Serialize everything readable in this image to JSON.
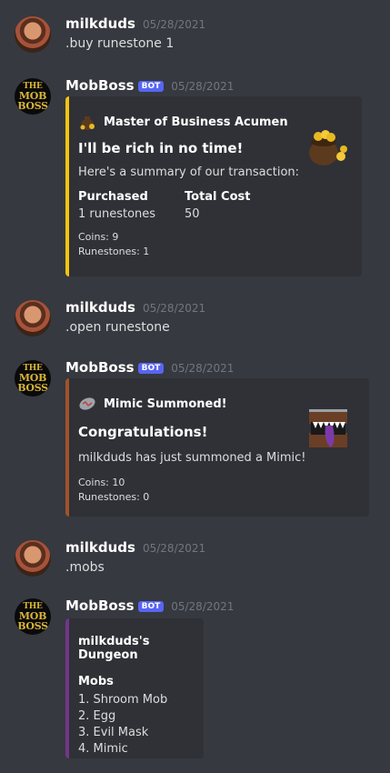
{
  "messages": [
    {
      "author": "milkduds",
      "timestamp": "05/28/2021",
      "text": ".buy runestone 1"
    },
    {
      "author": "MobBoss",
      "bot_tag": "BOT",
      "timestamp": "05/28/2021",
      "embed": {
        "color": "#f1c40f",
        "author_name": "Master of Business Acumen",
        "author_icon": "money-bag-icon",
        "title": "I'll be rich in no time!",
        "description": "Here's a summary of our transaction:",
        "fields": [
          {
            "name": "Purchased",
            "value": "1 runestones"
          },
          {
            "name": "Total Cost",
            "value": "50"
          }
        ],
        "footer_lines": [
          "Coins: 9",
          "Runestones: 1"
        ],
        "thumbnail": "gold-pot-icon"
      }
    },
    {
      "author": "milkduds",
      "timestamp": "05/28/2021",
      "text": ".open runestone"
    },
    {
      "author": "MobBoss",
      "bot_tag": "BOT",
      "timestamp": "05/28/2021",
      "embed": {
        "color": "#a0522d",
        "author_name": "Mimic Summoned!",
        "author_icon": "runestone-icon",
        "title": "Congratulations!",
        "description": "milkduds has just summoned a Mimic!",
        "footer_lines": [
          "Coins: 10",
          "Runestones: 0"
        ],
        "thumbnail": "mimic-chest-icon"
      }
    },
    {
      "author": "milkduds",
      "timestamp": "05/28/2021",
      "text": ".mobs"
    },
    {
      "author": "MobBoss",
      "bot_tag": "BOT",
      "timestamp": "05/28/2021",
      "embed": {
        "color": "#71368a",
        "title": "milkduds's Dungeon",
        "field_name": "Mobs",
        "items": [
          "1. Shroom Mob",
          "2. Egg",
          "3. Evil Mask",
          "4. Mimic"
        ]
      }
    }
  ],
  "bot_avatar_text": [
    "THE",
    "MOB",
    "BOSS"
  ]
}
